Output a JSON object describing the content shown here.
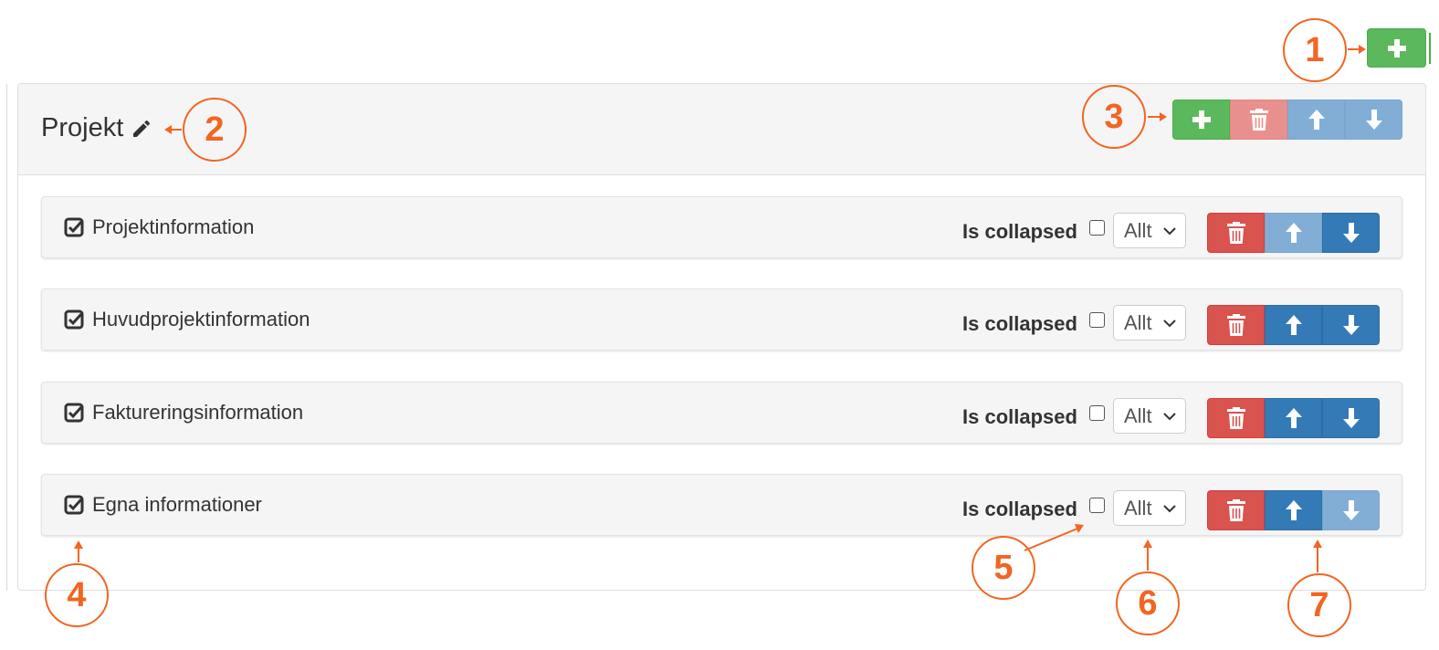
{
  "panel": {
    "title": "Projekt",
    "icons": {
      "edit": "pencil-icon",
      "add": "plus-icon",
      "delete": "trash-icon",
      "up": "arrow-up-icon",
      "down": "arrow-down-icon"
    }
  },
  "sections": [
    {
      "title": "Projektinformation",
      "collapsed_label": "Is collapsed",
      "collapsed": false,
      "select_value": "Allt"
    },
    {
      "title": "Huvudprojektinformation",
      "collapsed_label": "Is collapsed",
      "collapsed": false,
      "select_value": "Allt"
    },
    {
      "title": "Faktureringsinformation",
      "collapsed_label": "Is collapsed",
      "collapsed": false,
      "select_value": "Allt"
    },
    {
      "title": "Egna informationer",
      "collapsed_label": "Is collapsed",
      "collapsed": false,
      "select_value": "Allt"
    }
  ],
  "callouts": [
    "1",
    "2",
    "3",
    "4",
    "5",
    "6",
    "7"
  ],
  "colors": {
    "success": "#5cb85c",
    "danger": "#d9534f",
    "primary": "#337ab7",
    "callout": "#f26522",
    "panel_bg": "#f5f5f5"
  }
}
